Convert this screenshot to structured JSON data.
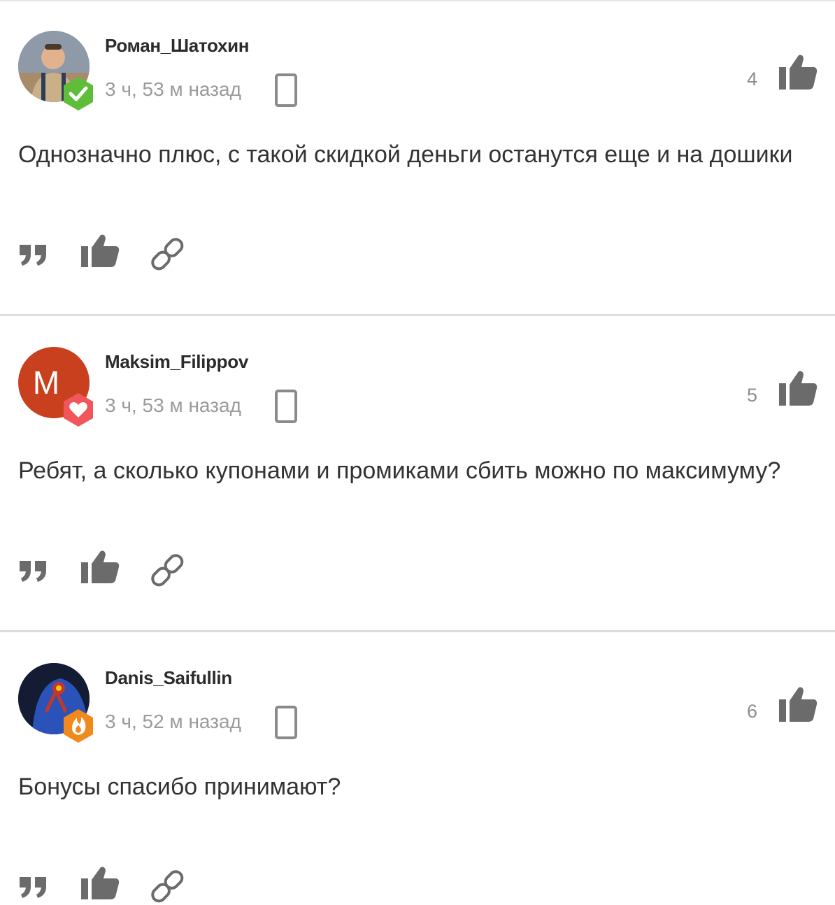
{
  "colors": {
    "text": "#333333",
    "muted": "#9a9a9a",
    "icon": "#6b6b6b",
    "divider": "#dcdde3",
    "badge_green": "#5fbd3a",
    "badge_red": "#f0565b",
    "badge_orange": "#f08a1c",
    "avatar_letter_bg": "#c8401d"
  },
  "comments": [
    {
      "author": "Роман_Шатохин",
      "time": "3 ч, 53 м назад",
      "likes": "4",
      "text": "Однозначно плюс, с такой скидкой деньги останутся еще и на дошики",
      "avatar": {
        "type": "photo"
      },
      "badge": {
        "icon": "check-badge-icon",
        "color": "#5fbd3a"
      }
    },
    {
      "author": "Maksim_Filippov",
      "time": "3 ч, 53 м назад",
      "likes": "5",
      "text": "Ребят, а сколько купонами и промиками сбить можно по максимуму?",
      "avatar": {
        "type": "letter",
        "letter": "M"
      },
      "badge": {
        "icon": "heart-badge-icon",
        "color": "#f0565b"
      }
    },
    {
      "author": "Danis_Saifullin",
      "time": "3 ч, 52 м назад",
      "likes": "6",
      "text": "Бонусы спасибо принимают?",
      "avatar": {
        "type": "photo"
      },
      "badge": {
        "icon": "fire-badge-icon",
        "color": "#f08a1c"
      }
    }
  ],
  "icons": {
    "device": "mobile-device-icon",
    "like": "thumbs-up-icon",
    "quote": "quote-icon",
    "link": "link-icon"
  }
}
